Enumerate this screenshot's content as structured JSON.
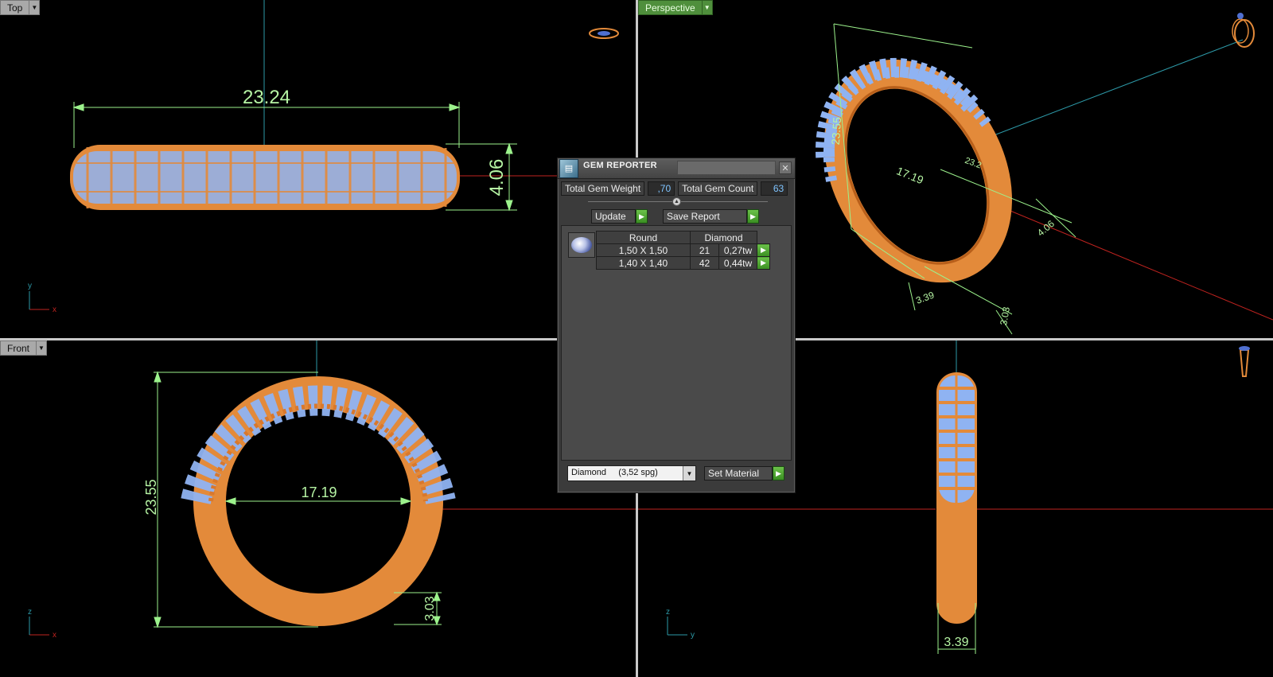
{
  "viewports": {
    "top": {
      "label": "Top",
      "axis_x": "x",
      "axis_y": "y",
      "dim_width": "23.24",
      "dim_height": "4.06"
    },
    "perspective": {
      "label": "Perspective",
      "dim_height": "23.55",
      "dim_inner": "17.19",
      "dim_band": "4.06",
      "dim_side": "3.39",
      "dim_thick": "3.03",
      "dim_small": "23.2"
    },
    "front": {
      "label": "Front",
      "axis_x": "x",
      "axis_y": "z",
      "dim_height": "23.55",
      "dim_inner": "17.19",
      "dim_thick": "3.03"
    },
    "right": {
      "axis_x": "y",
      "axis_y": "z",
      "dim_width": "3.39"
    }
  },
  "gem_reporter": {
    "title": "GEM REPORTER",
    "total_weight_label": "Total Gem Weight",
    "total_weight_value": ",70",
    "total_count_label": "Total Gem Count",
    "total_count_value": "63",
    "update_label": "Update",
    "save_report_label": "Save Report",
    "shape_header": "Round",
    "material_header": "Diamond",
    "rows": [
      {
        "size": "1,50 X 1,50",
        "count": "21",
        "weight": "0,27tw"
      },
      {
        "size": "1,40 X 1,40",
        "count": "42",
        "weight": "0,44tw"
      }
    ],
    "material_select": "Diamond     (3,52 spg)",
    "set_material_label": "Set Material"
  },
  "colors": {
    "metal": "#e38a3a",
    "gem": "#8fb3f2",
    "dimension": "#9cf28c",
    "axis_red": "#c0231f",
    "axis_teal": "#2d9aa8"
  }
}
